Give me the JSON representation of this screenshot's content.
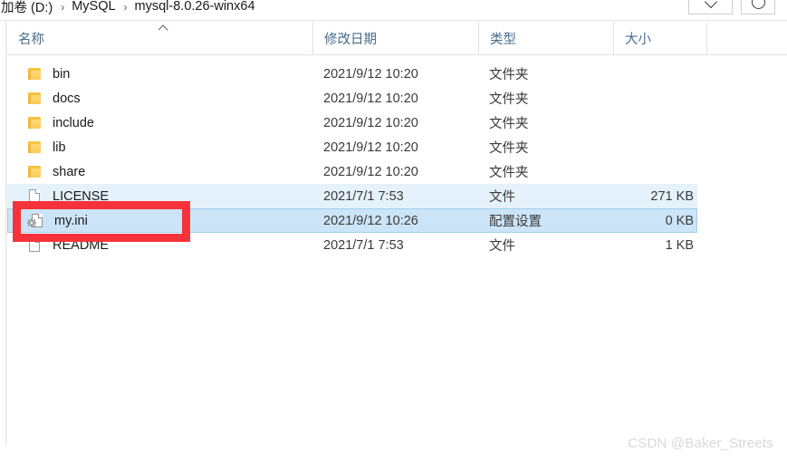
{
  "window": {
    "type": "file-explorer"
  },
  "address_bar": {
    "breadcrumb": [
      {
        "label": "加卷 (D:)"
      },
      {
        "label": "MySQL"
      },
      {
        "label": "mysql-8.0.26-winx64"
      }
    ],
    "separator": "›",
    "dropdown_icon": "chevron-down-icon",
    "refresh_icon": "refresh-icon"
  },
  "columns": [
    {
      "key": "name",
      "label": "名称",
      "sorted": "asc"
    },
    {
      "key": "date",
      "label": "修改日期"
    },
    {
      "key": "type",
      "label": "类型"
    },
    {
      "key": "size",
      "label": "大小"
    }
  ],
  "files": [
    {
      "name": "bin",
      "date": "2021/9/12 10:20",
      "type": "文件夹",
      "size": "",
      "icon": "folder-icon",
      "state": "normal"
    },
    {
      "name": "docs",
      "date": "2021/9/12 10:20",
      "type": "文件夹",
      "size": "",
      "icon": "folder-icon",
      "state": "normal"
    },
    {
      "name": "include",
      "date": "2021/9/12 10:20",
      "type": "文件夹",
      "size": "",
      "icon": "folder-icon",
      "state": "normal"
    },
    {
      "name": "lib",
      "date": "2021/9/12 10:20",
      "type": "文件夹",
      "size": "",
      "icon": "folder-icon",
      "state": "normal"
    },
    {
      "name": "share",
      "date": "2021/9/12 10:20",
      "type": "文件夹",
      "size": "",
      "icon": "folder-icon",
      "state": "normal"
    },
    {
      "name": "LICENSE",
      "date": "2021/7/1 7:53",
      "type": "文件",
      "size": "271 KB",
      "icon": "file-icon",
      "state": "selected"
    },
    {
      "name": "my.ini",
      "date": "2021/9/12 10:26",
      "type": "配置设置",
      "size": "0 KB",
      "icon": "config-file-icon",
      "state": "selected-focused"
    },
    {
      "name": "README",
      "date": "2021/7/1 7:53",
      "type": "文件",
      "size": "1 KB",
      "icon": "file-icon",
      "state": "normal"
    }
  ],
  "annotation": {
    "shape": "rectangle",
    "color": "#f6333a",
    "targets": "my.ini"
  },
  "watermark": {
    "text": "CSDN @Baker_Streets"
  },
  "colors": {
    "selection_light": "#e5f1fb",
    "selection_dark": "#cce4f7",
    "header_text": "#4a6d8c",
    "annotation_red": "#f6333a",
    "folder_yellow": "#f5c242"
  }
}
